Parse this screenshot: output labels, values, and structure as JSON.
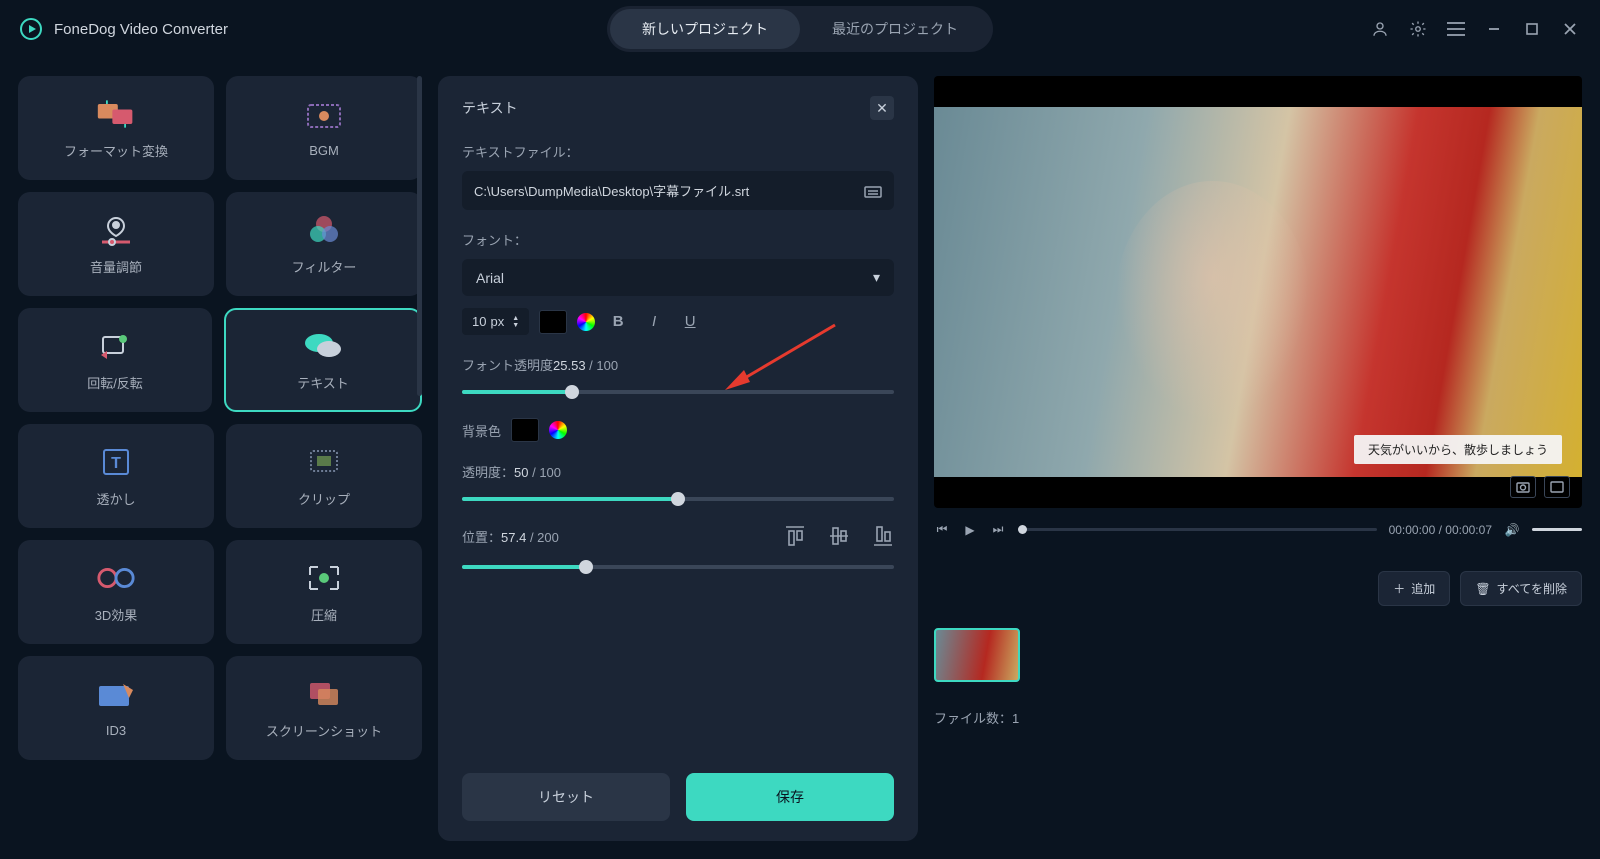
{
  "app": {
    "title": "FoneDog Video Converter"
  },
  "tabs": {
    "new": "新しいプロジェクト",
    "recent": "最近のプロジェクト"
  },
  "sidebar": [
    {
      "label": "フォーマット変換"
    },
    {
      "label": "BGM"
    },
    {
      "label": "音量調節"
    },
    {
      "label": "フィルター"
    },
    {
      "label": "回転/反転"
    },
    {
      "label": "テキスト"
    },
    {
      "label": "透かし"
    },
    {
      "label": "クリップ"
    },
    {
      "label": "3D効果"
    },
    {
      "label": "圧縮"
    },
    {
      "label": "ID3"
    },
    {
      "label": "スクリーンショット"
    }
  ],
  "panel": {
    "title": "テキスト",
    "file_label": "テキストファイル：",
    "file_path": "C:\\Users\\DumpMedia\\Desktop\\字幕ファイル.srt",
    "font_label": "フォント：",
    "font_name": "Arial",
    "font_size": "10",
    "font_unit": "px",
    "opacity_label": "フォント透明度",
    "opacity_value": "25.53",
    "opacity_max": " / 100",
    "bg_label": "背景色",
    "bg_opacity_label": "透明度：",
    "bg_opacity_value": "50",
    "bg_opacity_max": " / 100",
    "pos_label": "位置：",
    "pos_value": "57.4",
    "pos_max": " / 200",
    "reset": "リセット",
    "save": "保存"
  },
  "preview": {
    "subtitle": "天気がいいから、散歩しましょう",
    "time": "00:00:00 / 00:00:07"
  },
  "clips": {
    "add": "追加",
    "clear": "すべてを削除",
    "count_label": "ファイル数：",
    "count": "1"
  }
}
